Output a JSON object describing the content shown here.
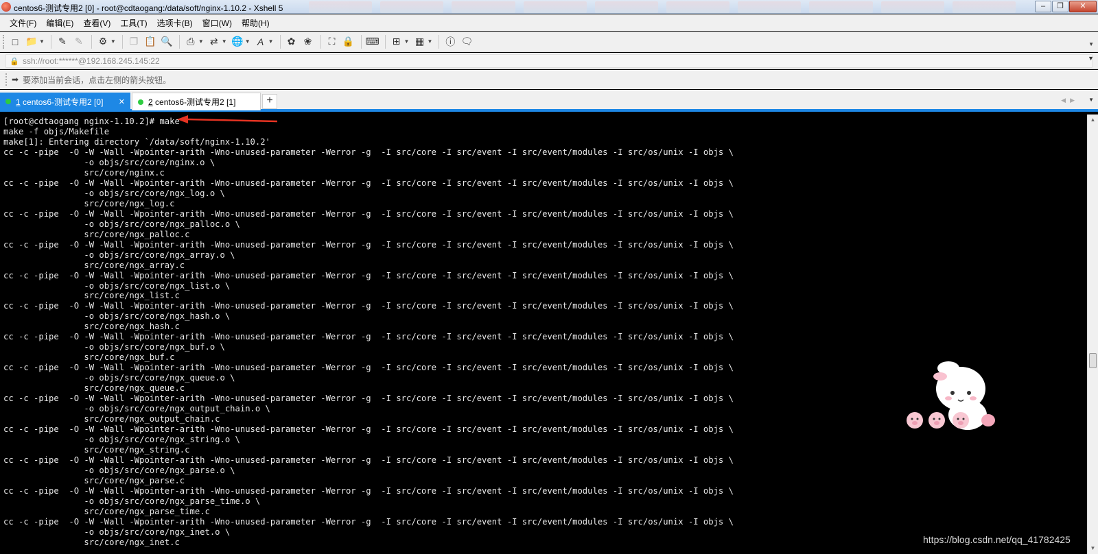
{
  "window": {
    "title": "centos6-测试专用2 [0] - root@cdtaogang:/data/soft/nginx-1.10.2 - Xshell 5",
    "minimize_icon": "minimize-icon",
    "maximize_icon": "restore-icon",
    "close_icon": "close-icon"
  },
  "menu": {
    "items": [
      {
        "label": "文件(F)"
      },
      {
        "label": "编辑(E)"
      },
      {
        "label": "查看(V)"
      },
      {
        "label": "工具(T)"
      },
      {
        "label": "选项卡(B)"
      },
      {
        "label": "窗口(W)"
      },
      {
        "label": "帮助(H)"
      }
    ]
  },
  "toolbar": {
    "icons": [
      "new-session-icon",
      "open-folder-icon",
      "reconnect-icon",
      "disconnect-icon",
      "properties-icon",
      "copy-icon",
      "paste-icon",
      "find-icon",
      "print-icon",
      "transfer-icon",
      "globe-icon",
      "font-icon",
      "xftp-icon",
      "xshell-icon",
      "fullscreen-icon",
      "lock-icon",
      "keyboard-icon",
      "add-session-icon",
      "layout-icon",
      "help-icon",
      "chat-icon"
    ]
  },
  "address": {
    "value": "ssh://root:******@192.168.245.145:22"
  },
  "hint": {
    "text": "要添加当前会话，点击左侧的箭头按钮。"
  },
  "tabs": [
    {
      "num": "1",
      "label": " centos6-测试专用2 [0]",
      "active": true,
      "status_color": "#2ecc40"
    },
    {
      "num": "2",
      "label": " centos6-测试专用2 [1]",
      "active": false,
      "status_color": "#2ecc40"
    }
  ],
  "add_tab_label": "+",
  "terminal": {
    "background": "#000000",
    "foreground": "#e8e8e8",
    "prompt": "[root@cdtaogang nginx-1.10.2]#",
    "command": "make",
    "lines": [
      "make -f objs/Makefile",
      "make[1]: Entering directory `/data/soft/nginx-1.10.2'",
      "cc -c -pipe  -O -W -Wall -Wpointer-arith -Wno-unused-parameter -Werror -g  -I src/core -I src/event -I src/event/modules -I src/os/unix -I objs \\",
      "                -o objs/src/core/nginx.o \\",
      "                src/core/nginx.c",
      "cc -c -pipe  -O -W -Wall -Wpointer-arith -Wno-unused-parameter -Werror -g  -I src/core -I src/event -I src/event/modules -I src/os/unix -I objs \\",
      "                -o objs/src/core/ngx_log.o \\",
      "                src/core/ngx_log.c",
      "cc -c -pipe  -O -W -Wall -Wpointer-arith -Wno-unused-parameter -Werror -g  -I src/core -I src/event -I src/event/modules -I src/os/unix -I objs \\",
      "                -o objs/src/core/ngx_palloc.o \\",
      "                src/core/ngx_palloc.c",
      "cc -c -pipe  -O -W -Wall -Wpointer-arith -Wno-unused-parameter -Werror -g  -I src/core -I src/event -I src/event/modules -I src/os/unix -I objs \\",
      "                -o objs/src/core/ngx_array.o \\",
      "                src/core/ngx_array.c",
      "cc -c -pipe  -O -W -Wall -Wpointer-arith -Wno-unused-parameter -Werror -g  -I src/core -I src/event -I src/event/modules -I src/os/unix -I objs \\",
      "                -o objs/src/core/ngx_list.o \\",
      "                src/core/ngx_list.c",
      "cc -c -pipe  -O -W -Wall -Wpointer-arith -Wno-unused-parameter -Werror -g  -I src/core -I src/event -I src/event/modules -I src/os/unix -I objs \\",
      "                -o objs/src/core/ngx_hash.o \\",
      "                src/core/ngx_hash.c",
      "cc -c -pipe  -O -W -Wall -Wpointer-arith -Wno-unused-parameter -Werror -g  -I src/core -I src/event -I src/event/modules -I src/os/unix -I objs \\",
      "                -o objs/src/core/ngx_buf.o \\",
      "                src/core/ngx_buf.c",
      "cc -c -pipe  -O -W -Wall -Wpointer-arith -Wno-unused-parameter -Werror -g  -I src/core -I src/event -I src/event/modules -I src/os/unix -I objs \\",
      "                -o objs/src/core/ngx_queue.o \\",
      "                src/core/ngx_queue.c",
      "cc -c -pipe  -O -W -Wall -Wpointer-arith -Wno-unused-parameter -Werror -g  -I src/core -I src/event -I src/event/modules -I src/os/unix -I objs \\",
      "                -o objs/src/core/ngx_output_chain.o \\",
      "                src/core/ngx_output_chain.c",
      "cc -c -pipe  -O -W -Wall -Wpointer-arith -Wno-unused-parameter -Werror -g  -I src/core -I src/event -I src/event/modules -I src/os/unix -I objs \\",
      "                -o objs/src/core/ngx_string.o \\",
      "                src/core/ngx_string.c",
      "cc -c -pipe  -O -W -Wall -Wpointer-arith -Wno-unused-parameter -Werror -g  -I src/core -I src/event -I src/event/modules -I src/os/unix -I objs \\",
      "                -o objs/src/core/ngx_parse.o \\",
      "                src/core/ngx_parse.c",
      "cc -c -pipe  -O -W -Wall -Wpointer-arith -Wno-unused-parameter -Werror -g  -I src/core -I src/event -I src/event/modules -I src/os/unix -I objs \\",
      "                -o objs/src/core/ngx_parse_time.o \\",
      "                src/core/ngx_parse_time.c",
      "cc -c -pipe  -O -W -Wall -Wpointer-arith -Wno-unused-parameter -Werror -g  -I src/core -I src/event -I src/event/modules -I src/os/unix -I objs \\",
      "                -o objs/src/core/ngx_inet.o \\",
      "                src/core/ngx_inet.c"
    ]
  },
  "annotation_color": "#e53322",
  "watermark": "https://blog.csdn.net/qq_41782425"
}
